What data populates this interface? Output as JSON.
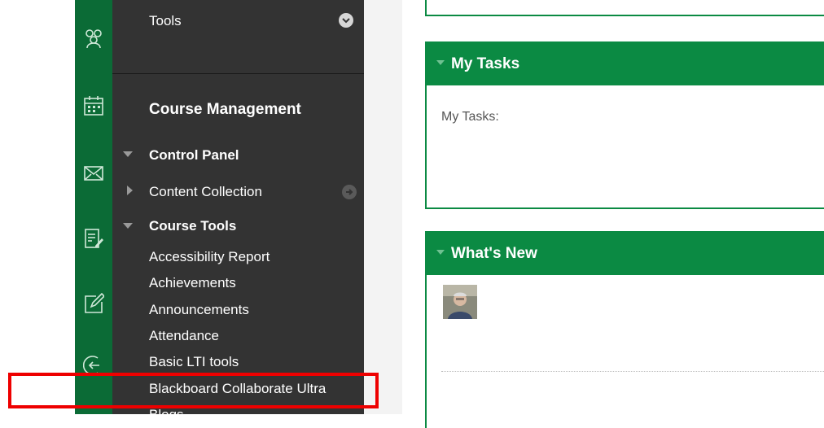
{
  "rail": {
    "icons": [
      "people-icon",
      "calendar-icon",
      "mail-icon",
      "grades-icon",
      "edit-icon",
      "logout-icon"
    ]
  },
  "sidebar": {
    "tools_label": "Tools",
    "course_management": "Course Management",
    "control_panel": "Control Panel",
    "content_collection": "Content Collection",
    "course_tools": "Course Tools",
    "items": [
      "Accessibility Report",
      "Achievements",
      "Announcements",
      "Attendance",
      "Basic LTI tools",
      "Blackboard Collaborate Ultra",
      "Blogs"
    ]
  },
  "modules": {
    "my_tasks": {
      "title": "My Tasks",
      "body": "My Tasks:"
    },
    "whats_new": {
      "title": "What's New"
    }
  },
  "colors": {
    "rail_green": "#0b6b36",
    "module_green": "#0b8a43",
    "sidebar_bg": "#333333",
    "highlight": "#ee0000"
  }
}
